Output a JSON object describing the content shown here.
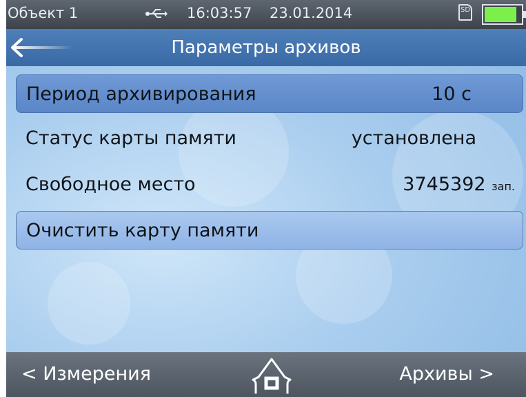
{
  "status_bar": {
    "object_name": "Объект 1",
    "usb_icon": "usb-icon",
    "time": "16:03:57",
    "date": "23.01.2014",
    "sd_label": "SD",
    "battery_icon": "battery-icon"
  },
  "header": {
    "back_icon": "back-arrow-icon",
    "title": "Параметры архивов"
  },
  "rows": [
    {
      "label": "Период архивирования",
      "value": "10 с"
    },
    {
      "label": "Статус карты памяти",
      "value": "установлена"
    },
    {
      "label": "Свободное место",
      "value": "3745392",
      "unit": "зап."
    },
    {
      "label": "Очистить карту памяти"
    }
  ],
  "footer": {
    "left_label": "< Измерения",
    "home_icon": "home-icon",
    "right_label": "Архивы >"
  },
  "colors": {
    "accent": "#3a6aa6",
    "selected_row": "#5b86c7",
    "battery_fill": "#7cf04a"
  }
}
